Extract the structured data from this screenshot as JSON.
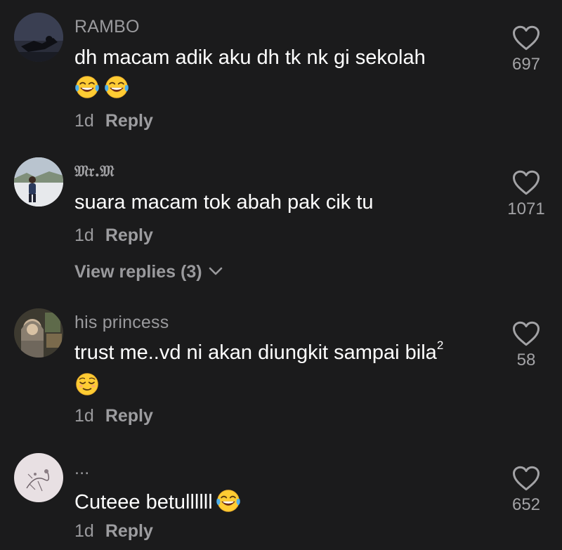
{
  "comments": [
    {
      "username": "RAMBO",
      "text": "dh macam adik aku dh tk nk gi sekolah",
      "emojis": [
        "face-with-tears-of-joy",
        "face-with-tears-of-joy"
      ],
      "age": "1d",
      "reply_label": "Reply",
      "likes": "697"
    },
    {
      "username": "𝔐𝔯.𝔐",
      "text": "suara macam tok abah pak cik tu",
      "age": "1d",
      "reply_label": "Reply",
      "view_replies": "View replies (3)",
      "likes": "1071"
    },
    {
      "username": "his princess",
      "text": "trust me..vd ni akan diungkit sampai bila",
      "text_sup": "2",
      "emojis": [
        "relieved-face"
      ],
      "age": "1d",
      "reply_label": "Reply",
      "likes": "58"
    },
    {
      "username": "...",
      "text": "Cuteee betullllll",
      "emojis": [
        "face-with-tears-of-joy"
      ],
      "age": "1d",
      "reply_label": "Reply",
      "likes": "652"
    }
  ],
  "colors": {
    "background": "#1b1b1c",
    "primary_text": "#ffffff",
    "secondary_text": "#9a9a9d",
    "emoji_yellow": "#ffcc33",
    "tear_blue": "#4fb0ec"
  }
}
